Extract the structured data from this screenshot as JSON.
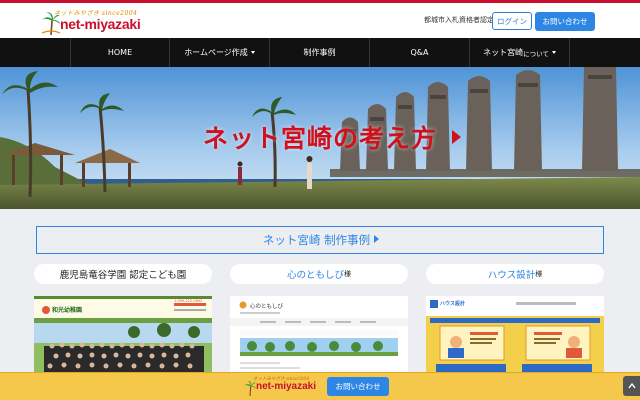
{
  "header": {
    "logo_tagline": "ネットみやざき since2004",
    "logo_name": "net-miyazaki",
    "certification": "都城市入札資格者認定",
    "login_label": "ログイン",
    "contact_label": "お問い合わせ"
  },
  "nav": {
    "items": [
      {
        "label": "HOME",
        "dropdown": false
      },
      {
        "label": "ホームページ作成",
        "dropdown": true
      },
      {
        "label": "制作事例",
        "dropdown": false
      },
      {
        "label": "Q&A",
        "dropdown": false
      },
      {
        "label": "ネット宮崎",
        "sub": "について",
        "dropdown": true
      }
    ]
  },
  "hero": {
    "title": "ネット宮崎の考え方"
  },
  "works": {
    "title": "ネット宮崎 制作事例",
    "cards": [
      {
        "name": "鹿児島竜谷学園 認定こども園",
        "suffix": "",
        "highlight": false
      },
      {
        "name": "心のともしび",
        "suffix": "様",
        "highlight": true
      },
      {
        "name": "ハウス設計",
        "suffix": "様",
        "highlight": true
      }
    ],
    "thumb1": {
      "site": "和光幼稚園",
      "phone": "1-099-222-0692"
    },
    "thumb2": {
      "site": "心のともしび"
    },
    "thumb3": {
      "site": "ハウス設計"
    }
  },
  "footer": {
    "logo_tagline": "ネットみやざき since2004",
    "logo_name": "net-miyazaki",
    "contact_label": "お問い合わせ"
  },
  "colors": {
    "brand_red": "#c8102e",
    "accent_blue": "#2d86e4",
    "footer_yellow": "#f5c84c"
  }
}
